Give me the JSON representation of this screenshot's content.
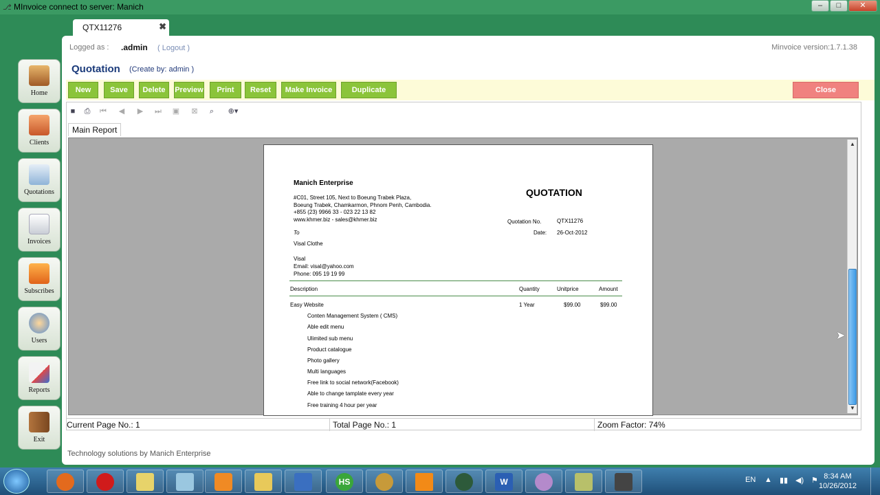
{
  "window": {
    "title": "MInvoice connect to server: Manich",
    "controls": [
      "minimize-icon",
      "maximize-icon",
      "close-icon"
    ]
  },
  "sidebar": {
    "items": [
      {
        "label": "Home",
        "icon": "home-icon"
      },
      {
        "label": "Clients",
        "icon": "clients-icon"
      },
      {
        "label": "Quotations",
        "icon": "quotations-icon"
      },
      {
        "label": "Invoices",
        "icon": "invoices-icon"
      },
      {
        "label": "Subscribes",
        "icon": "rss-icon"
      },
      {
        "label": "Users",
        "icon": "user-icon"
      },
      {
        "label": "Reports",
        "icon": "reports-icon"
      },
      {
        "label": "Exit",
        "icon": "exit-icon"
      }
    ]
  },
  "tab": {
    "label": "QTX11276",
    "close": "✖"
  },
  "header": {
    "logged_as_label": "Logged as :",
    "user": ".admin",
    "logout": "( Logout )",
    "version": "Minvoice version:1.7.1.38",
    "page_title": "Quotation",
    "create_by": "(Create by: admin )"
  },
  "toolbar": {
    "buttons": [
      "New",
      "Save",
      "Delete",
      "Preview",
      "Print",
      "Reset",
      "Make Invoice",
      "Duplicate"
    ],
    "close": "Close"
  },
  "report": {
    "tab": "Main Report",
    "icons": [
      "save-icon",
      "print-icon",
      "first-page-icon",
      "prev-page-icon",
      "next-page-icon",
      "last-page-icon",
      "export-icon",
      "stop-icon",
      "find-icon",
      "zoom-icon"
    ],
    "status": {
      "current_page": "Current Page No.: 1",
      "total_page": "Total Page No.: 1",
      "zoom": "Zoom Factor: 74%"
    }
  },
  "document": {
    "company": "Manich Enterprise",
    "address_lines": [
      "#C01, Street 105, Next to Boeung Trabek Plaza,",
      "Boeung Trabek, Chamkarmon, Phnom Penh, Cambodia.",
      "+855 (23) 9966 33 - 023 22 13 82",
      "www.khmer.biz - sales@khmer.biz"
    ],
    "doc_title": "QUOTATION",
    "quotation_no_label": "Quotation No.",
    "quotation_no": "QTX11276",
    "date_label": "Date:",
    "date": "26-Oct-2012",
    "to_label": "To",
    "client": "Visal Clothe",
    "contact_name": "Visal",
    "contact_email": "Email: visal@yahoo.com",
    "contact_phone": "Phone: 095 19 19 99",
    "columns": [
      "Description",
      "Quantity",
      "Unitprice",
      "Amount"
    ],
    "line_item": {
      "description": "Easy Website",
      "quantity": "1 Year",
      "unitprice": "$99.00",
      "amount": "$99.00"
    },
    "features": [
      "Conten Management System ( CMS)",
      "Able edit menu",
      "Ulimited sub menu",
      "Product catalogue",
      "Photo gallery",
      "Multi languages",
      "Free link to social network(Facebook)",
      "Able to change tamplate every year",
      "Free training 4 hour per year"
    ]
  },
  "footer": "Technology solutions by Manich Enterprise",
  "taskbar": {
    "apps": [
      "firefox-icon",
      "opera-icon",
      "folder-icon",
      "notepad-icon",
      "media-player-icon",
      "explorer-icon",
      "remote-icon",
      "hotspot-icon",
      "paint-icon",
      "vlc-icon",
      "minvoice-icon",
      "word-icon",
      "chat-icon",
      "image-icon",
      "camera-icon"
    ],
    "hotspot_text": "HS",
    "word_text": "W",
    "lang": "EN",
    "time": "8:34 AM",
    "date": "10/26/2012"
  },
  "colors": {
    "app_green": "#2e8b57",
    "button_green": "#8bc43a",
    "close_red": "#f0827f",
    "toolbar_yellow": "#fdfbd8",
    "title_blue": "#1a3a7a"
  }
}
